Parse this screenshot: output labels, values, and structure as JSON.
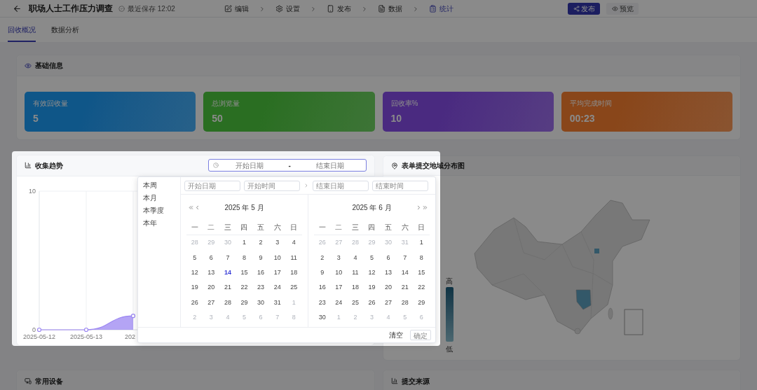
{
  "header": {
    "title": "职场人士工作压力调查",
    "save_status": "最近保存 12:02",
    "steps": [
      {
        "label": "编辑",
        "kind": "edit",
        "selected": false
      },
      {
        "label": "设置",
        "kind": "settings",
        "selected": false
      },
      {
        "label": "发布",
        "kind": "publish",
        "selected": false
      },
      {
        "label": "数据",
        "kind": "data",
        "selected": false
      },
      {
        "label": "统计",
        "kind": "stats",
        "selected": true
      }
    ],
    "buttons": [
      {
        "label": "发布",
        "kind": "primary"
      },
      {
        "label": "预览",
        "kind": "secondary"
      }
    ]
  },
  "tabs": [
    {
      "label": "回收概况",
      "selected": true
    },
    {
      "label": "数据分析",
      "selected": false
    }
  ],
  "basic_info": {
    "title": "基础信息",
    "stats": [
      {
        "label": "有效回收量",
        "value": "5",
        "color": "#0f5688"
      },
      {
        "label": "总浏览量",
        "value": "50",
        "color": "#2a6e22"
      },
      {
        "label": "回收率%",
        "value": "10",
        "color": "#4a2a80"
      },
      {
        "label": "平均完成时间",
        "value": "00:23",
        "color": "#89461a"
      }
    ]
  },
  "trend_card": {
    "title": "收集趋势",
    "date_range": {
      "start_placeholder": "开始日期",
      "separator": "-",
      "end_placeholder": "结束日期"
    },
    "chart_data": {
      "type": "area",
      "categories": [
        "2025-05-12",
        "2025-05-13",
        "202"
      ],
      "ylim": [
        0,
        10
      ],
      "yticks": [
        0,
        10
      ],
      "series": [
        {
          "color": "#9b86f2",
          "values": [
            0,
            0,
            1
          ]
        }
      ]
    }
  },
  "date_picker": {
    "shortcuts": [
      "本周",
      "本月",
      "本季度",
      "本年"
    ],
    "start_date_placeholder": "开始日期",
    "start_time_placeholder": "开始时间",
    "end_date_placeholder": "结束日期",
    "end_time_placeholder": "结束时间",
    "months": [
      {
        "title": "2025 年 5 月",
        "weekdays": [
          "一",
          "二",
          "三",
          "四",
          "五",
          "六",
          "日"
        ],
        "weeks": [
          [
            {
              "d": "28",
              "outside": true,
              "today": false
            },
            {
              "d": "29",
              "outside": true,
              "today": false
            },
            {
              "d": "30",
              "outside": true,
              "today": false
            },
            {
              "d": "1",
              "outside": false,
              "today": false
            },
            {
              "d": "2",
              "outside": false,
              "today": false
            },
            {
              "d": "3",
              "outside": false,
              "today": false
            },
            {
              "d": "4",
              "outside": false,
              "today": false
            }
          ],
          [
            {
              "d": "5",
              "outside": false,
              "today": false
            },
            {
              "d": "6",
              "outside": false,
              "today": false
            },
            {
              "d": "7",
              "outside": false,
              "today": false
            },
            {
              "d": "8",
              "outside": false,
              "today": false
            },
            {
              "d": "9",
              "outside": false,
              "today": false
            },
            {
              "d": "10",
              "outside": false,
              "today": false
            },
            {
              "d": "11",
              "outside": false,
              "today": false
            }
          ],
          [
            {
              "d": "12",
              "outside": false,
              "today": false
            },
            {
              "d": "13",
              "outside": false,
              "today": false
            },
            {
              "d": "14",
              "outside": false,
              "today": true
            },
            {
              "d": "15",
              "outside": false,
              "today": false
            },
            {
              "d": "16",
              "outside": false,
              "today": false
            },
            {
              "d": "17",
              "outside": false,
              "today": false
            },
            {
              "d": "18",
              "outside": false,
              "today": false
            }
          ],
          [
            {
              "d": "19",
              "outside": false,
              "today": false
            },
            {
              "d": "20",
              "outside": false,
              "today": false
            },
            {
              "d": "21",
              "outside": false,
              "today": false
            },
            {
              "d": "22",
              "outside": false,
              "today": false
            },
            {
              "d": "23",
              "outside": false,
              "today": false
            },
            {
              "d": "24",
              "outside": false,
              "today": false
            },
            {
              "d": "25",
              "outside": false,
              "today": false
            }
          ],
          [
            {
              "d": "26",
              "outside": false,
              "today": false
            },
            {
              "d": "27",
              "outside": false,
              "today": false
            },
            {
              "d": "28",
              "outside": false,
              "today": false
            },
            {
              "d": "29",
              "outside": false,
              "today": false
            },
            {
              "d": "30",
              "outside": false,
              "today": false
            },
            {
              "d": "31",
              "outside": false,
              "today": false
            },
            {
              "d": "1",
              "outside": true,
              "today": false
            }
          ],
          [
            {
              "d": "2",
              "outside": true,
              "today": false
            },
            {
              "d": "3",
              "outside": true,
              "today": false
            },
            {
              "d": "4",
              "outside": true,
              "today": false
            },
            {
              "d": "5",
              "outside": true,
              "today": false
            },
            {
              "d": "6",
              "outside": true,
              "today": false
            },
            {
              "d": "7",
              "outside": true,
              "today": false
            },
            {
              "d": "8",
              "outside": true,
              "today": false
            }
          ]
        ]
      },
      {
        "title": "2025 年 6 月",
        "weekdays": [
          "一",
          "二",
          "三",
          "四",
          "五",
          "六",
          "日"
        ],
        "weeks": [
          [
            {
              "d": "26",
              "outside": true,
              "today": false
            },
            {
              "d": "27",
              "outside": true,
              "today": false
            },
            {
              "d": "28",
              "outside": true,
              "today": false
            },
            {
              "d": "29",
              "outside": true,
              "today": false
            },
            {
              "d": "30",
              "outside": true,
              "today": false
            },
            {
              "d": "31",
              "outside": true,
              "today": false
            },
            {
              "d": "1",
              "outside": false,
              "today": false
            }
          ],
          [
            {
              "d": "2",
              "outside": false,
              "today": false
            },
            {
              "d": "3",
              "outside": false,
              "today": false
            },
            {
              "d": "4",
              "outside": false,
              "today": false
            },
            {
              "d": "5",
              "outside": false,
              "today": false
            },
            {
              "d": "6",
              "outside": false,
              "today": false
            },
            {
              "d": "7",
              "outside": false,
              "today": false
            },
            {
              "d": "8",
              "outside": false,
              "today": false
            }
          ],
          [
            {
              "d": "9",
              "outside": false,
              "today": false
            },
            {
              "d": "10",
              "outside": false,
              "today": false
            },
            {
              "d": "11",
              "outside": false,
              "today": false
            },
            {
              "d": "12",
              "outside": false,
              "today": false
            },
            {
              "d": "13",
              "outside": false,
              "today": false
            },
            {
              "d": "14",
              "outside": false,
              "today": false
            },
            {
              "d": "15",
              "outside": false,
              "today": false
            }
          ],
          [
            {
              "d": "16",
              "outside": false,
              "today": false
            },
            {
              "d": "17",
              "outside": false,
              "today": false
            },
            {
              "d": "18",
              "outside": false,
              "today": false
            },
            {
              "d": "19",
              "outside": false,
              "today": false
            },
            {
              "d": "20",
              "outside": false,
              "today": false
            },
            {
              "d": "21",
              "outside": false,
              "today": false
            },
            {
              "d": "22",
              "outside": false,
              "today": false
            }
          ],
          [
            {
              "d": "23",
              "outside": false,
              "today": false
            },
            {
              "d": "24",
              "outside": false,
              "today": false
            },
            {
              "d": "25",
              "outside": false,
              "today": false
            },
            {
              "d": "26",
              "outside": false,
              "today": false
            },
            {
              "d": "27",
              "outside": false,
              "today": false
            },
            {
              "d": "28",
              "outside": false,
              "today": false
            },
            {
              "d": "29",
              "outside": false,
              "today": false
            }
          ],
          [
            {
              "d": "30",
              "outside": false,
              "today": false
            },
            {
              "d": "1",
              "outside": true,
              "today": false
            },
            {
              "d": "2",
              "outside": true,
              "today": false
            },
            {
              "d": "3",
              "outside": true,
              "today": false
            },
            {
              "d": "4",
              "outside": true,
              "today": false
            },
            {
              "d": "5",
              "outside": true,
              "today": false
            },
            {
              "d": "6",
              "outside": true,
              "today": false
            }
          ]
        ]
      }
    ],
    "clear": "清空",
    "confirm": "确定"
  },
  "map_card": {
    "title": "表单提交地域分布图",
    "legend_high": "高",
    "legend_low": "低"
  },
  "bottom_cards": [
    {
      "title": "常用设备",
      "kind": "devices"
    },
    {
      "title": "提交来源",
      "kind": "sources"
    }
  ]
}
